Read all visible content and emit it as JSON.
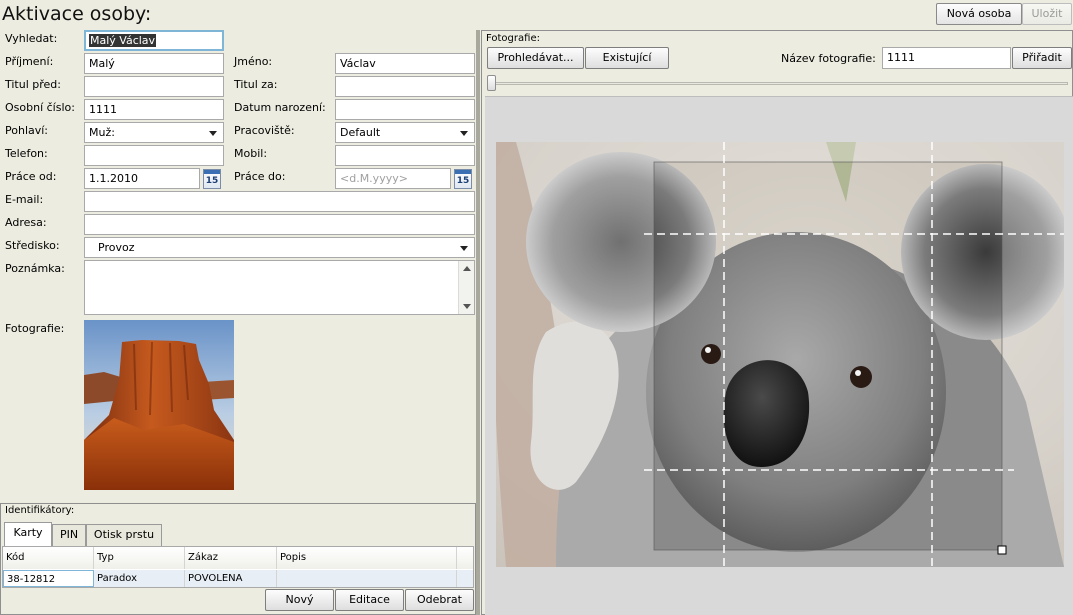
{
  "page": {
    "title": "Aktivace osoby:"
  },
  "toolbar": {
    "new_person": "Nová osoba",
    "save": "Uložit"
  },
  "form": {
    "search": {
      "label": "Vyhledat:",
      "value": "Malý Václav"
    },
    "surname": {
      "label": "Příjmení:",
      "value": "Malý"
    },
    "firstname": {
      "label": "Jméno:",
      "value": "Václav"
    },
    "title_before": {
      "label": "Titul před:",
      "value": ""
    },
    "title_after": {
      "label": "Titul za:",
      "value": ""
    },
    "personal_number": {
      "label": "Osobní číslo:",
      "value": "1111"
    },
    "birth_date": {
      "label": "Datum narození:",
      "value": ""
    },
    "gender": {
      "label": "Pohlaví:",
      "value": "Muž:"
    },
    "workplace": {
      "label": "Pracoviště:",
      "value": "Default"
    },
    "phone": {
      "label": "Telefon:",
      "value": ""
    },
    "mobile": {
      "label": "Mobil:",
      "value": ""
    },
    "work_from": {
      "label": "Práce od:",
      "value": "1.1.2010",
      "calendar_icon_text": "15"
    },
    "work_to": {
      "label": "Práce do:",
      "placeholder": "<d.M.yyyy>",
      "calendar_icon_text": "15"
    },
    "email": {
      "label": "E-mail:",
      "value": ""
    },
    "address": {
      "label": "Adresa:",
      "value": ""
    },
    "center": {
      "label": "Středisko:",
      "value": "Provoz"
    },
    "note": {
      "label": "Poznámka:",
      "value": ""
    },
    "photo": {
      "label": "Fotografie:"
    }
  },
  "identifiers": {
    "title": "Identifikátory:",
    "tabs": [
      {
        "label": "Karty"
      },
      {
        "label": "PIN"
      },
      {
        "label": "Otisk prstu"
      }
    ],
    "columns": [
      "Kód",
      "Typ",
      "Zákaz",
      "Popis"
    ],
    "rows": [
      {
        "code": "38-12812",
        "type": "Paradox",
        "ban": "POVOLENA",
        "desc": ""
      }
    ],
    "buttons": {
      "new": "Nový",
      "edit": "Editace",
      "remove": "Odebrat"
    }
  },
  "photo_panel": {
    "title": "Fotografie:",
    "browse": "Prohledávat...",
    "existing": "Existující",
    "name_label": "Název fotografie:",
    "name_value": "1111",
    "assign": "Přiřadit",
    "zoom_level": 0
  },
  "colors": {
    "focus_border": "#7fb6d8",
    "selection": "#333333",
    "panel_bg": "#ecece0"
  }
}
